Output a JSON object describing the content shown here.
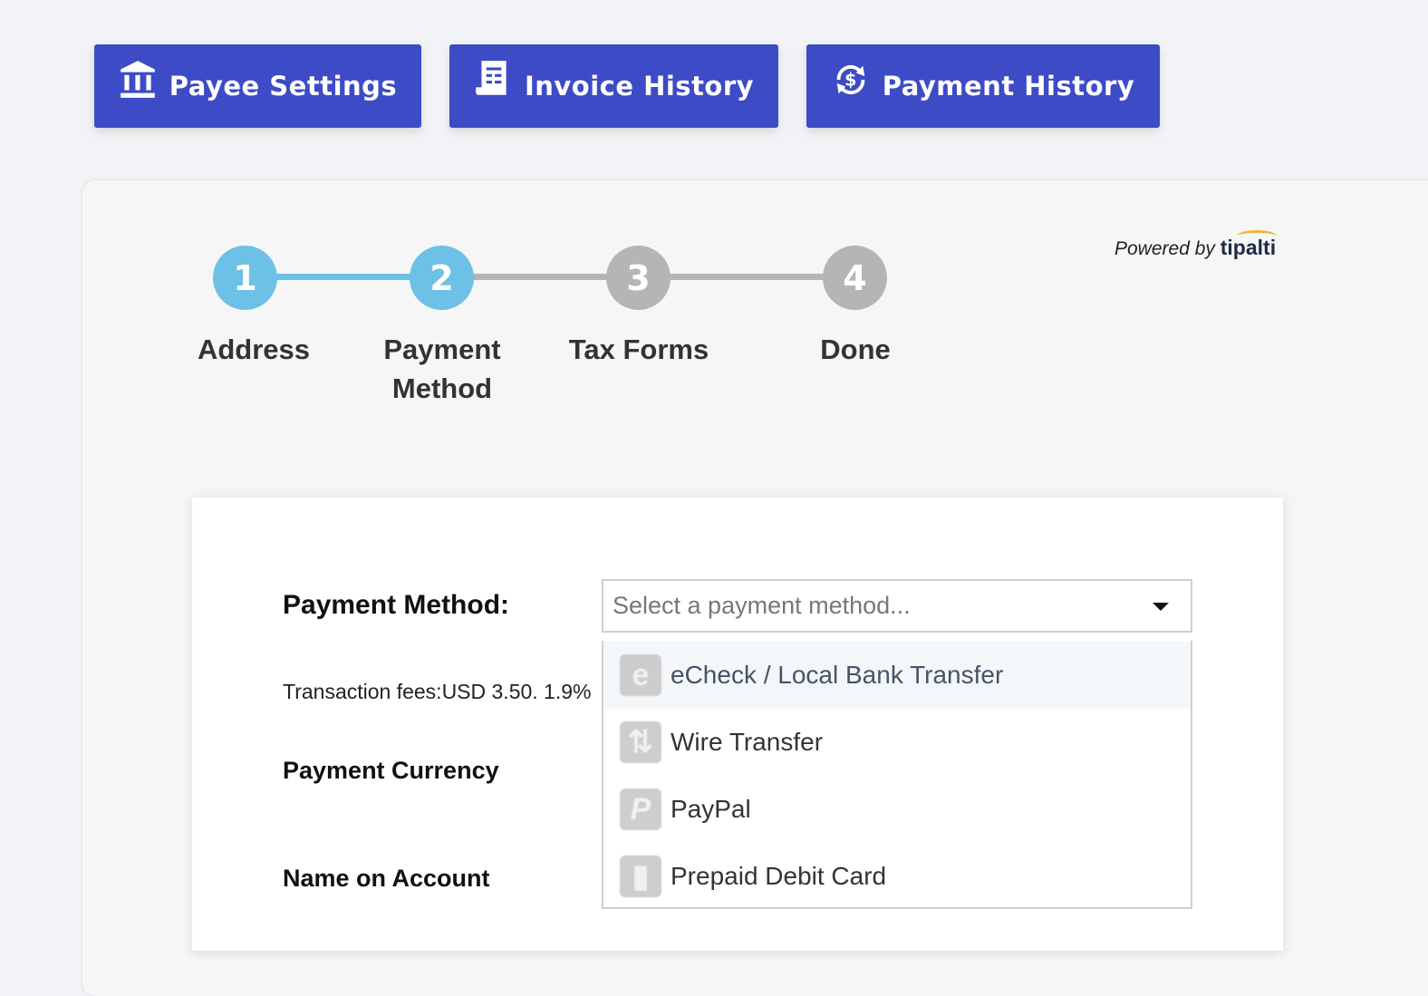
{
  "nav": {
    "payee_settings": "Payee Settings",
    "invoice_history": "Invoice History",
    "payment_history": "Payment History"
  },
  "powered_by": {
    "prefix": "Powered by",
    "brand": "tipalti"
  },
  "stepper": {
    "steps": [
      {
        "number": "1",
        "label": "Address",
        "state": "complete"
      },
      {
        "number": "2",
        "label": "Payment Method",
        "state": "active"
      },
      {
        "number": "3",
        "label": "Tax Forms",
        "state": "inactive"
      },
      {
        "number": "4",
        "label": "Done",
        "state": "inactive"
      }
    ]
  },
  "form": {
    "payment_method_label": "Payment Method:",
    "payment_method_placeholder": "Select a payment method...",
    "transaction_fees": "Transaction fees:USD 3.50. 1.9%",
    "payment_currency_label": "Payment Currency",
    "name_on_account_label": "Name on Account"
  },
  "dropdown": {
    "options": [
      {
        "label": "eCheck / Local Bank Transfer",
        "icon": "echeck-icon",
        "highlighted": true
      },
      {
        "label": "Wire Transfer",
        "icon": "wire-transfer-icon",
        "highlighted": false
      },
      {
        "label": "PayPal",
        "icon": "paypal-icon",
        "highlighted": false
      },
      {
        "label": "Prepaid Debit Card",
        "icon": "debit-card-icon",
        "highlighted": false
      }
    ]
  },
  "colors": {
    "nav_button": "#3d4bc6",
    "step_active": "#6ec1e6",
    "step_inactive": "#b5b5b5"
  }
}
